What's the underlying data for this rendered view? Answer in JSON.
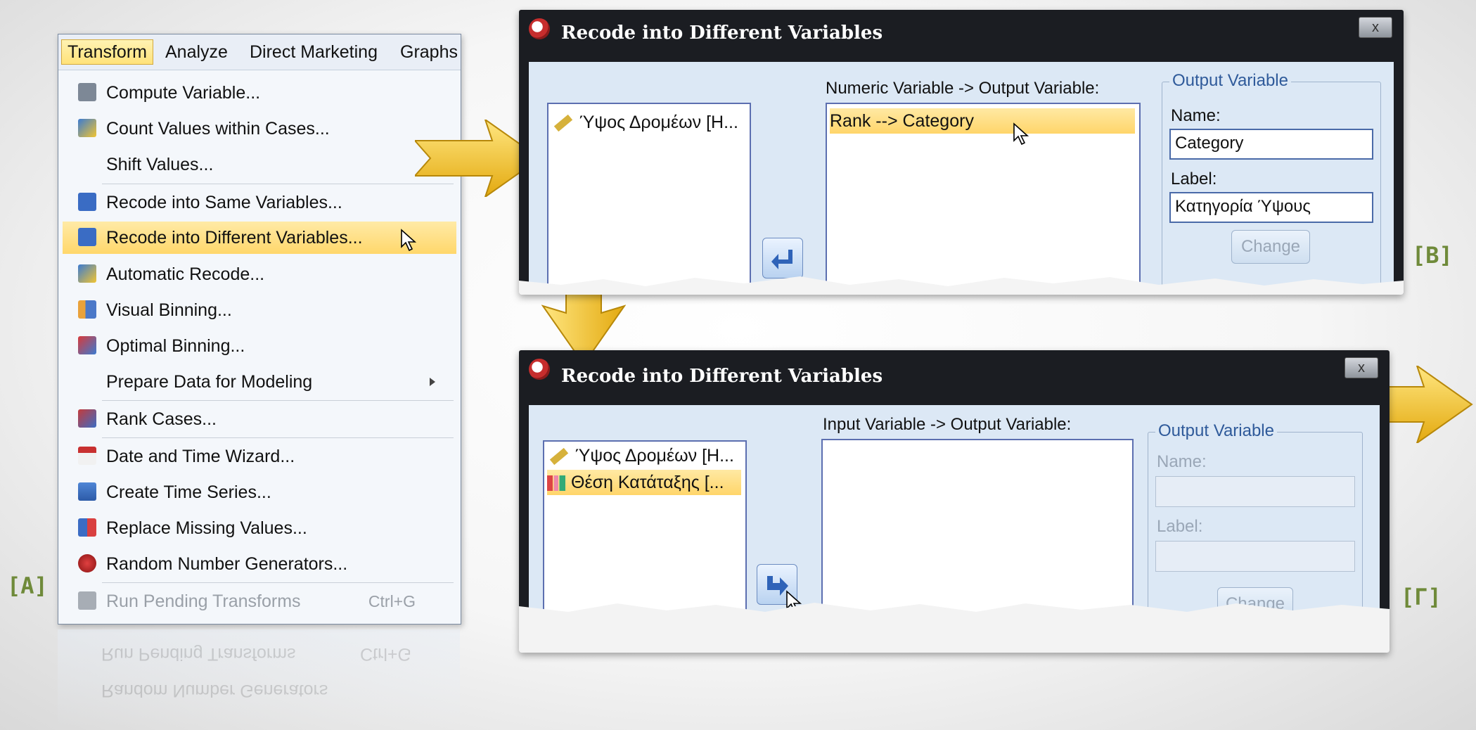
{
  "menu": {
    "bar": [
      "Transform",
      "Analyze",
      "Direct Marketing",
      "Graphs"
    ],
    "items": [
      {
        "label": "Compute Variable...",
        "icon": "calculator-icon"
      },
      {
        "label": "Count Values within Cases...",
        "icon": "count-values-icon"
      },
      {
        "label": "Shift Values..."
      },
      {
        "label": "Recode into Same Variables...",
        "icon": "recode-same-icon"
      },
      {
        "label": "Recode into Different Variables...",
        "icon": "recode-different-icon"
      },
      {
        "label": "Automatic Recode...",
        "icon": "automatic-recode-icon"
      },
      {
        "label": "Visual Binning...",
        "icon": "visual-binning-icon"
      },
      {
        "label": "Optimal Binning...",
        "icon": "optimal-binning-icon"
      },
      {
        "label": "Prepare Data for Modeling"
      },
      {
        "label": "Rank Cases...",
        "icon": "rank-cases-icon"
      },
      {
        "label": "Date and Time Wizard...",
        "icon": "calendar-icon"
      },
      {
        "label": "Create Time Series...",
        "icon": "time-series-icon"
      },
      {
        "label": "Replace Missing Values...",
        "icon": "replace-missing-icon"
      },
      {
        "label": "Random Number Generators...",
        "icon": "dice-icon"
      },
      {
        "label": "Run Pending Transforms",
        "shortcut": "Ctrl+G",
        "icon": "run-pending-icon"
      }
    ],
    "reflection": [
      "Run Pending Transforms",
      "Ctrl+G",
      "Random Number Generators"
    ]
  },
  "dialog_b": {
    "title": "Recode into Different Variables",
    "close": "x",
    "source_item": "Ύψος Δρομέων [H...",
    "list_header": "Numeric Variable -> Output Variable:",
    "list_item": "Rank --> Category",
    "output_group": "Output Variable",
    "name_label": "Name:",
    "name_value": "Category",
    "label_label": "Label:",
    "label_value": "Κατηγορία Ύψους",
    "change": "Change"
  },
  "dialog_g": {
    "title": "Recode into Different Variables",
    "close": "x",
    "source_items": [
      "Ύψος Δρομέων [H...",
      "Θέση Κατάταξης [..."
    ],
    "list_header": "Input Variable -> Output Variable:",
    "output_group": "Output Variable",
    "name_label": "Name:",
    "label_label": "Label:",
    "change": "Change"
  },
  "labels": {
    "a": "[A]",
    "b": "[B]",
    "g": "[Γ]"
  },
  "colors": {
    "highlight": "#ffd76b",
    "dialog_bg": "#dce8f5",
    "arrow": "#f3c52a"
  }
}
